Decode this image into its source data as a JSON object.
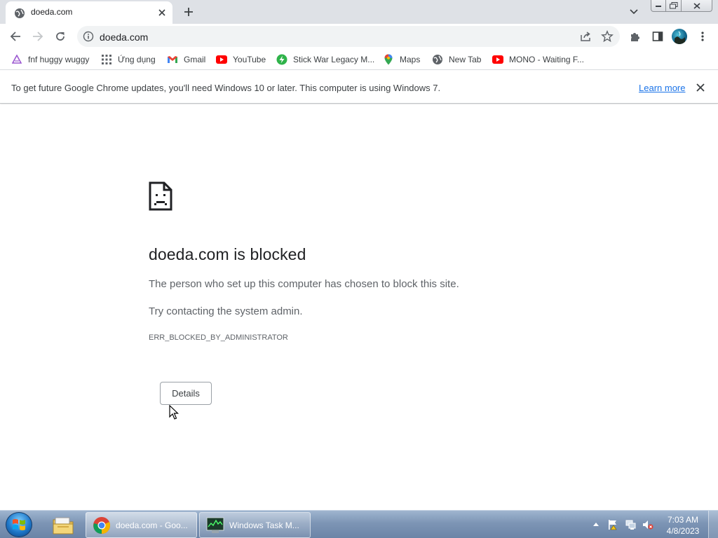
{
  "browser": {
    "tab": {
      "title": "doeda.com",
      "favicon": "globe-icon"
    },
    "window_controls": [
      "minimize-icon",
      "maximize-icon",
      "close-icon"
    ]
  },
  "toolbar": {
    "url": "doeda.com",
    "icons": [
      "back-arrow-icon",
      "forward-arrow-icon",
      "reload-icon",
      "site-info-icon",
      "share-icon",
      "star-icon",
      "extensions-icon",
      "side-panel-icon",
      "profile-avatar",
      "menu-kebab-icon"
    ]
  },
  "bookmarks": [
    {
      "label": "fnf huggy wuggy",
      "icon": "triangle-icon"
    },
    {
      "label": "Ứng dụng",
      "icon": "apps-grid-icon"
    },
    {
      "label": "Gmail",
      "icon": "gmail-icon"
    },
    {
      "label": "YouTube",
      "icon": "youtube-icon"
    },
    {
      "label": "Stick War Legacy M...",
      "icon": "green-bolt-icon"
    },
    {
      "label": "Maps",
      "icon": "maps-pin-icon"
    },
    {
      "label": "New Tab",
      "icon": "globe-icon"
    },
    {
      "label": "MONO - Waiting F...",
      "icon": "youtube-icon"
    }
  ],
  "infobar": {
    "message": "To get future Google Chrome updates, you'll need Windows 10 or later. This computer is using Windows 7.",
    "link": "Learn more"
  },
  "error_page": {
    "heading": "doeda.com is blocked",
    "message": "The person who set up this computer has chosen to block this site.",
    "suggestion": "Try contacting the system admin.",
    "error_code": "ERR_BLOCKED_BY_ADMINISTRATOR",
    "details_button": "Details"
  },
  "taskbar": {
    "tasks": [
      {
        "label": "doeda.com - Goo...",
        "icon": "chrome-icon",
        "active": true
      },
      {
        "label": "Windows Task M...",
        "icon": "task-manager-icon",
        "active": false
      }
    ],
    "clock": {
      "time": "7:03 AM",
      "date": "4/8/2023"
    }
  }
}
